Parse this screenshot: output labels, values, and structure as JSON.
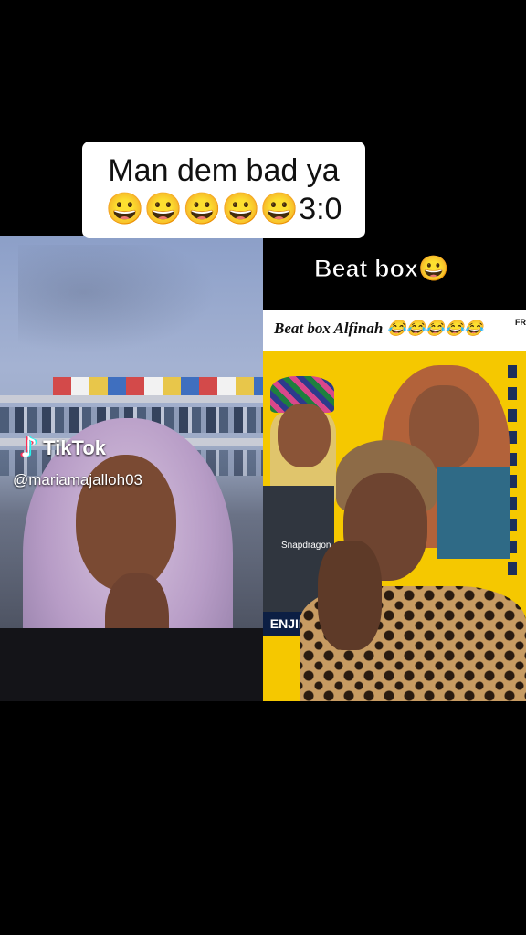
{
  "caption": {
    "line1": "Man dem bad ya",
    "line2": "😀😀😀😀😀3:0"
  },
  "left_panel": {
    "watermark": {
      "logo_text": "TikTok",
      "logo_icon": "tiktok-note-icon",
      "handle": "@mariamajalloh03"
    }
  },
  "right_panel": {
    "title": "Beat box😀",
    "poster": {
      "title": "Beat box Alfinah 😂😂😂😂😂",
      "corner_text": "FR",
      "label": "ENJIE",
      "shirt_text": "Snapdragon"
    }
  }
}
